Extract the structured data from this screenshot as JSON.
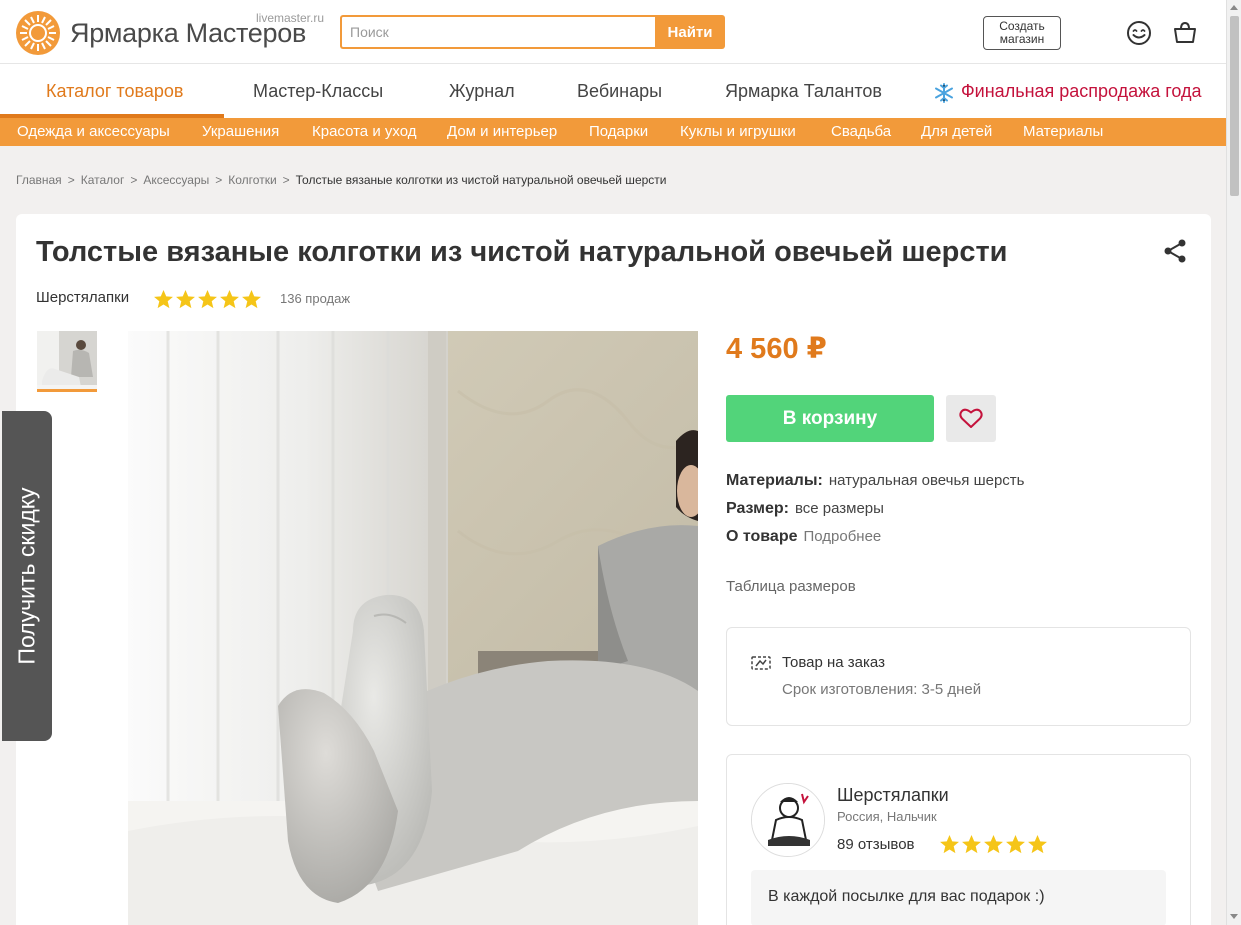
{
  "header": {
    "logo_text": "Ярмарка Мастеров",
    "logo_domain": "livemaster.ru",
    "search_placeholder": "Поиск",
    "search_button": "Найти",
    "create_shop": "Создать\nмагазин"
  },
  "main_nav": {
    "items": [
      "Каталог товаров",
      "Мастер-Классы",
      "Журнал",
      "Вебинары",
      "Ярмарка Талантов"
    ],
    "promo": "Финальная распродажа года"
  },
  "categories": [
    "Одежда и аксессуары",
    "Украшения",
    "Красота и уход",
    "Дом и интерьер",
    "Подарки",
    "Куклы и игрушки",
    "Свадьба",
    "Для детей",
    "Материалы"
  ],
  "breadcrumbs": [
    "Главная",
    "Каталог",
    "Аксессуары",
    "Колготки",
    "Толстые вязаные колготки из чистой натуральной овечьей шерсти"
  ],
  "product": {
    "title": "Толстые вязаные колготки из чистой натуральной овечьей шерсти",
    "seller": "Шерстялапки",
    "rating_stars": 5,
    "sales": "136 продаж",
    "price": "4 560 ₽",
    "add_to_cart": "В корзину",
    "attributes": {
      "materials_label": "Материалы:",
      "materials_value": "натуральная овечья шерсть",
      "size_label": "Размер:",
      "size_value": "все размеры",
      "about_label": "О товаре",
      "about_value": "Подробнее"
    },
    "size_table": "Таблица размеров",
    "order": {
      "title": "Товар на заказ",
      "lead_time": "Срок изготовления: 3-5 дней"
    }
  },
  "shop": {
    "name": "Шерстялапки",
    "location": "Россия, Нальчик",
    "reviews": "89 отзывов",
    "rating_stars": 5,
    "note": "В каждой посылке для вас подарок :)"
  },
  "side_tab": "Получить скидку",
  "colors": {
    "accent": "#f29a3a",
    "price": "#e07a1c",
    "cart": "#52d47a",
    "promo": "#c4123c",
    "star": "#f5c518"
  }
}
